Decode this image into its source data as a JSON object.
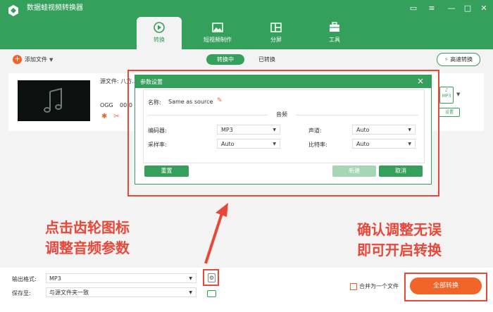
{
  "app": {
    "title": "数据蛙视频转换器",
    "tabs": [
      {
        "label": "转换"
      },
      {
        "label": "短视频制作"
      },
      {
        "label": "分屏"
      },
      {
        "label": "工具"
      }
    ]
  },
  "toolbar": {
    "add_file": "添加文件",
    "seg_converting": "转换中",
    "seg_converted": "已转换",
    "high_speed": "高速转换"
  },
  "file": {
    "source_label": "源文件:",
    "source_value": "八方...",
    "format": "OGG",
    "time": "00:0",
    "output_format_badge": "MP3",
    "settings_tag": "设置"
  },
  "dialog": {
    "title": "参数设置",
    "name_label": "名称:",
    "name_value": "Same as source",
    "section_audio": "音频",
    "encoder_label": "编码器:",
    "encoder_value": "MP3",
    "samplerate_label": "采样率:",
    "samplerate_value": "Auto",
    "channel_label": "声道:",
    "channel_value": "Auto",
    "bitrate_label": "比特率:",
    "bitrate_value": "Auto",
    "reset": "重置",
    "new": "新建",
    "cancel": "取消"
  },
  "bottom": {
    "output_format_label": "输出格式:",
    "output_format_value": "MP3",
    "save_to_label": "保存至:",
    "save_to_value": "与源文件夹一致",
    "merge_label": "合并为一个文件",
    "convert_all": "全部转换"
  },
  "annotations": {
    "left_line1": "点击齿轮图标",
    "left_line2": "调整音频参数",
    "right_line1": "确认调整无误",
    "right_line2": "即可开启转换"
  },
  "colors": {
    "brand_green": "#35a05c",
    "accent_orange": "#f0642a",
    "annotation_red": "#e8483a"
  }
}
